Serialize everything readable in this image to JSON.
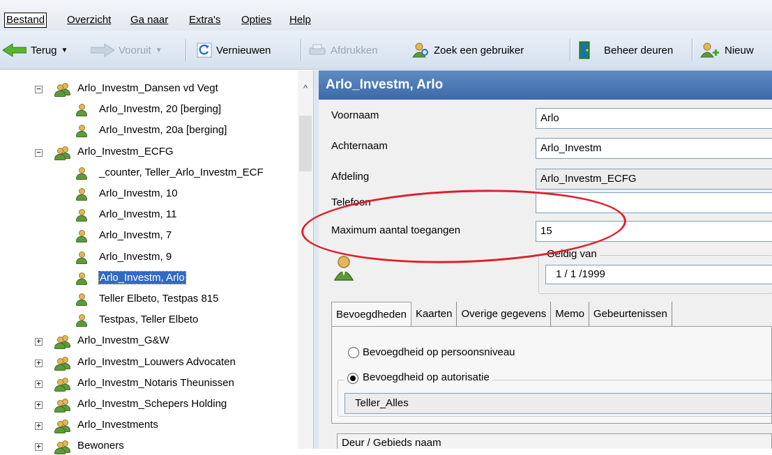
{
  "menu": {
    "items": [
      {
        "label": "Bestand"
      },
      {
        "label": "Overzicht"
      },
      {
        "label": "Ga naar"
      },
      {
        "label": "Extra's"
      },
      {
        "label": "Opties"
      },
      {
        "label": "Help"
      }
    ]
  },
  "toolbar": {
    "back": "Terug",
    "forward": "Vooruit",
    "refresh": "Vernieuwen",
    "print": "Afdrukken",
    "find_user": "Zoek een gebruiker",
    "manage_doors": "Beheer deuren",
    "new": "Nieuw"
  },
  "tree": {
    "nodes": [
      {
        "label": "Arlo_Investm_Dansen vd Vegt",
        "type": "group",
        "state": "expanded"
      },
      {
        "label": "Arlo_Investm, 20 [berging]",
        "type": "person"
      },
      {
        "label": "Arlo_Investm, 20a [berging]",
        "type": "person"
      },
      {
        "label": "Arlo_Investm_ECFG",
        "type": "group",
        "state": "expanded"
      },
      {
        "label": "_counter, Teller_Arlo_Investm_ECF",
        "type": "person"
      },
      {
        "label": "Arlo_Investm, 10",
        "type": "person"
      },
      {
        "label": "Arlo_Investm, 11",
        "type": "person"
      },
      {
        "label": "Arlo_Investm, 7",
        "type": "person"
      },
      {
        "label": "Arlo_Investm, 9",
        "type": "person"
      },
      {
        "label": "Arlo_Investm, Arlo",
        "type": "person",
        "selected": true
      },
      {
        "label": "Teller Elbeto, Testpas 815",
        "type": "person"
      },
      {
        "label": "Testpas, Teller Elbeto",
        "type": "person"
      },
      {
        "label": "Arlo_Investm_G&W",
        "type": "group",
        "state": "collapsed"
      },
      {
        "label": "Arlo_Investm_Louwers Advocaten",
        "type": "group",
        "state": "collapsed"
      },
      {
        "label": "Arlo_Investm_Notaris Theunissen",
        "type": "group",
        "state": "collapsed"
      },
      {
        "label": "Arlo_Investm_Schepers Holding",
        "type": "group",
        "state": "collapsed"
      },
      {
        "label": "Arlo_Investments",
        "type": "group",
        "state": "collapsed"
      },
      {
        "label": "Bewoners",
        "type": "group",
        "state": "collapsed"
      }
    ]
  },
  "detail": {
    "title": "Arlo_Investm, Arlo",
    "fields": {
      "voornaam_label": "Voornaam",
      "voornaam_value": "Arlo",
      "achternaam_label": "Achternaam",
      "achternaam_value": "Arlo_Investm",
      "afdeling_label": "Afdeling",
      "afdeling_value": "Arlo_Investm_ECFG",
      "telefoon_label": "Telefoon",
      "telefoon_value": "",
      "max_label": "Maximum aantal toegangen",
      "max_value": "15",
      "geldig_label": "Geldig van",
      "geldig_value": "1 / 1 /1999"
    },
    "tabs": [
      "Bevoegdheden",
      "Kaarten",
      "Overige gegevens",
      "Memo",
      "Gebeurtenissen"
    ],
    "radio_personal": "Bevoegdheid op persoonsniveau",
    "radio_authorization": "Bevoegdheid op autorisatie",
    "authorization_value": "Teller_Alles",
    "grid_header": "Deur / Gebieds naam"
  },
  "colors": {
    "header_blue": "#4a78b4",
    "selection": "#316ac5",
    "annotation_red": "#e11d2a"
  }
}
